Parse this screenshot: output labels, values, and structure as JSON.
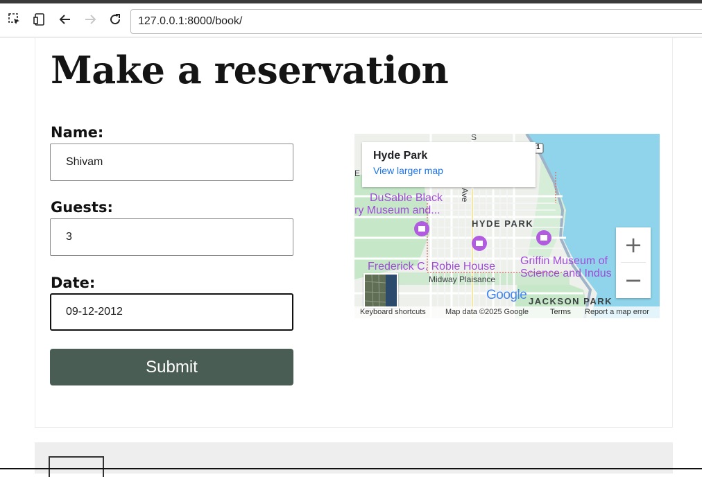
{
  "browser": {
    "url": "127.0.0.1:8000/book/",
    "icons": [
      "inspect-icon",
      "device-toolbar-icon",
      "back-arrow-icon",
      "forward-arrow-icon",
      "reload-icon"
    ]
  },
  "page": {
    "title": "Make a reservation"
  },
  "form": {
    "name_label": "Name:",
    "name_value": "Shivam",
    "guests_label": "Guests:",
    "guests_value": "3",
    "date_label": "Date:",
    "date_value": "09-12-2012",
    "submit_label": "Submit",
    "submit_color": "#4a5d55"
  },
  "map": {
    "place_name": "Hyde Park",
    "view_larger": "View larger map",
    "poi_1_line1": "DuSable Black",
    "poi_1_line2": "ry Museum and...",
    "area_hyde_park": "HYDE PARK",
    "poi_2": "Frederick C. Robie House",
    "street_midway": "Midway Plaisance",
    "poi_3_line1": "Griffin Museum of",
    "poi_3_line2": "Science and Indus",
    "area_jackson_park": "JACKSON PARK",
    "street_ave": "Ave",
    "route_number": "1",
    "edge_letter_s": "S",
    "edge_letter_e": "E",
    "zoom_in": "+",
    "zoom_out": "−",
    "google": "Google",
    "keyboard_shortcuts": "Keyboard shortcuts",
    "map_data": "Map data ©2025 Google",
    "terms": "Terms",
    "report_error": "Report a map error",
    "water_color": "#8fd4ea",
    "park_color": "#c6e8c9"
  }
}
